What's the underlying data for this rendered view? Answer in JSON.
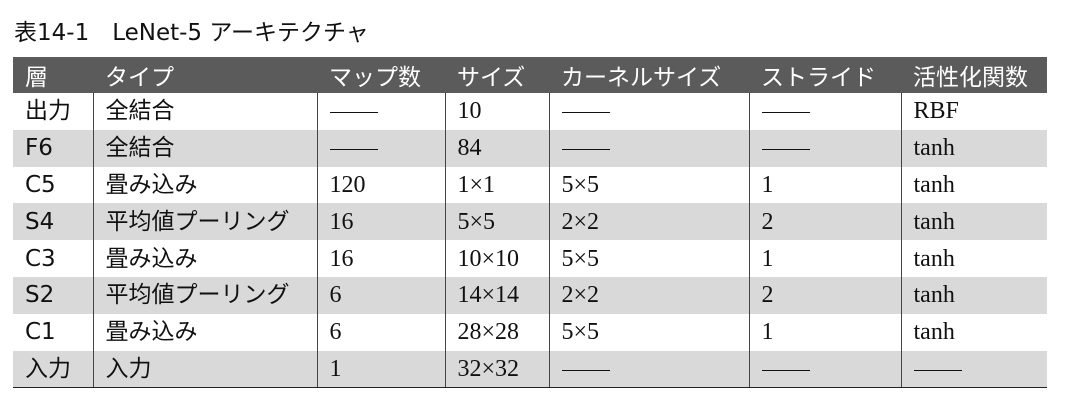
{
  "caption": "表14-1　LeNet-5 アーキテクチャ",
  "headers": [
    "層",
    "タイプ",
    "マップ数",
    "サイズ",
    "カーネルサイズ",
    "ストライド",
    "活性化関数"
  ],
  "rows": [
    [
      "出力",
      "全結合",
      "—",
      "10",
      "—",
      "—",
      "RBF"
    ],
    [
      "F6",
      "全結合",
      "—",
      "84",
      "—",
      "—",
      "tanh"
    ],
    [
      "C5",
      "畳み込み",
      "120",
      "1×1",
      "5×5",
      "1",
      "tanh"
    ],
    [
      "S4",
      "平均値プーリング",
      "16",
      "5×5",
      "2×2",
      "2",
      "tanh"
    ],
    [
      "C3",
      "畳み込み",
      "16",
      "10×10",
      "5×5",
      "1",
      "tanh"
    ],
    [
      "S2",
      "平均値プーリング",
      "6",
      "14×14",
      "2×2",
      "2",
      "tanh"
    ],
    [
      "C1",
      "畳み込み",
      "6",
      "28×28",
      "5×5",
      "1",
      "tanh"
    ],
    [
      "入力",
      "入力",
      "1",
      "32×32",
      "—",
      "—",
      "—"
    ]
  ]
}
